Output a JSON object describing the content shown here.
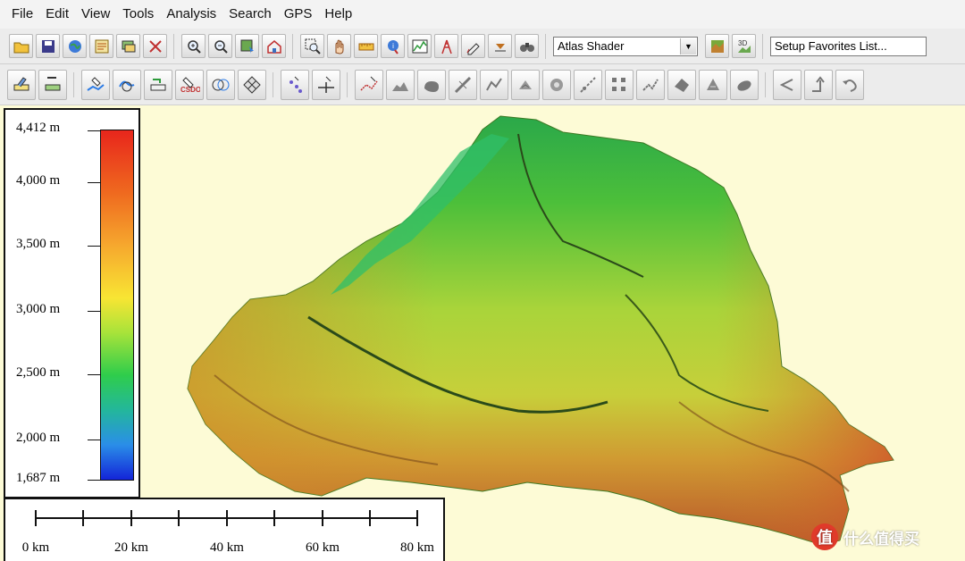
{
  "menu": [
    "File",
    "Edit",
    "View",
    "Tools",
    "Analysis",
    "Search",
    "GPS",
    "Help"
  ],
  "toolbar1": {
    "shader_select": "Atlas Shader",
    "favorites_select": "Setup Favorites List...",
    "buttons_a": [
      "open-folder-icon",
      "save-icon",
      "globe-icon",
      "map-catalog-icon",
      "layer-control-icon",
      "tools-icon"
    ],
    "buttons_b": [
      "zoom-in-icon",
      "zoom-out-icon",
      "download-data-icon",
      "home-icon"
    ],
    "buttons_c": [
      "zoom-rect-icon",
      "pan-hand-icon",
      "measure-icon",
      "info-icon",
      "path-profile-icon",
      "tower-icon",
      "digitize-icon",
      "dropdown-icon",
      "binoculars-icon"
    ],
    "buttons_d": [
      "shader-color-icon",
      "3d-view-icon"
    ]
  },
  "toolbar2": {
    "buttons": [
      "edit-area-icon",
      "edit-line-icon",
      "digitize-line-icon",
      "draw-feature-icon",
      "split-line-icon",
      "csv-export-icon",
      "combine-areas-icon",
      "grid-icon",
      "point-feature-icon",
      "line-cross-icon",
      "vertex-edit-icon",
      "terrain-slice-icon",
      "shape-blob-icon",
      "path-tool-icon",
      "route-icon",
      "crop-icon",
      "fill-icon",
      "measure-path-icon",
      "nodes-icon",
      "polyline-icon",
      "cutout-icon",
      "rotate-icon",
      "ellipse-icon",
      "angle-icon",
      "arrow-up-icon",
      "undo-curve-icon"
    ]
  },
  "legend": {
    "labels": [
      "4,412 m",
      "4,000 m",
      "3,500 m",
      "3,000 m",
      "2,500 m",
      "2,000 m",
      "1,687 m"
    ]
  },
  "scale": {
    "labels": [
      "0 km",
      "20 km",
      "40 km",
      "60 km",
      "80 km"
    ]
  },
  "watermark": {
    "logo": "值",
    "text": "什么值得买"
  }
}
